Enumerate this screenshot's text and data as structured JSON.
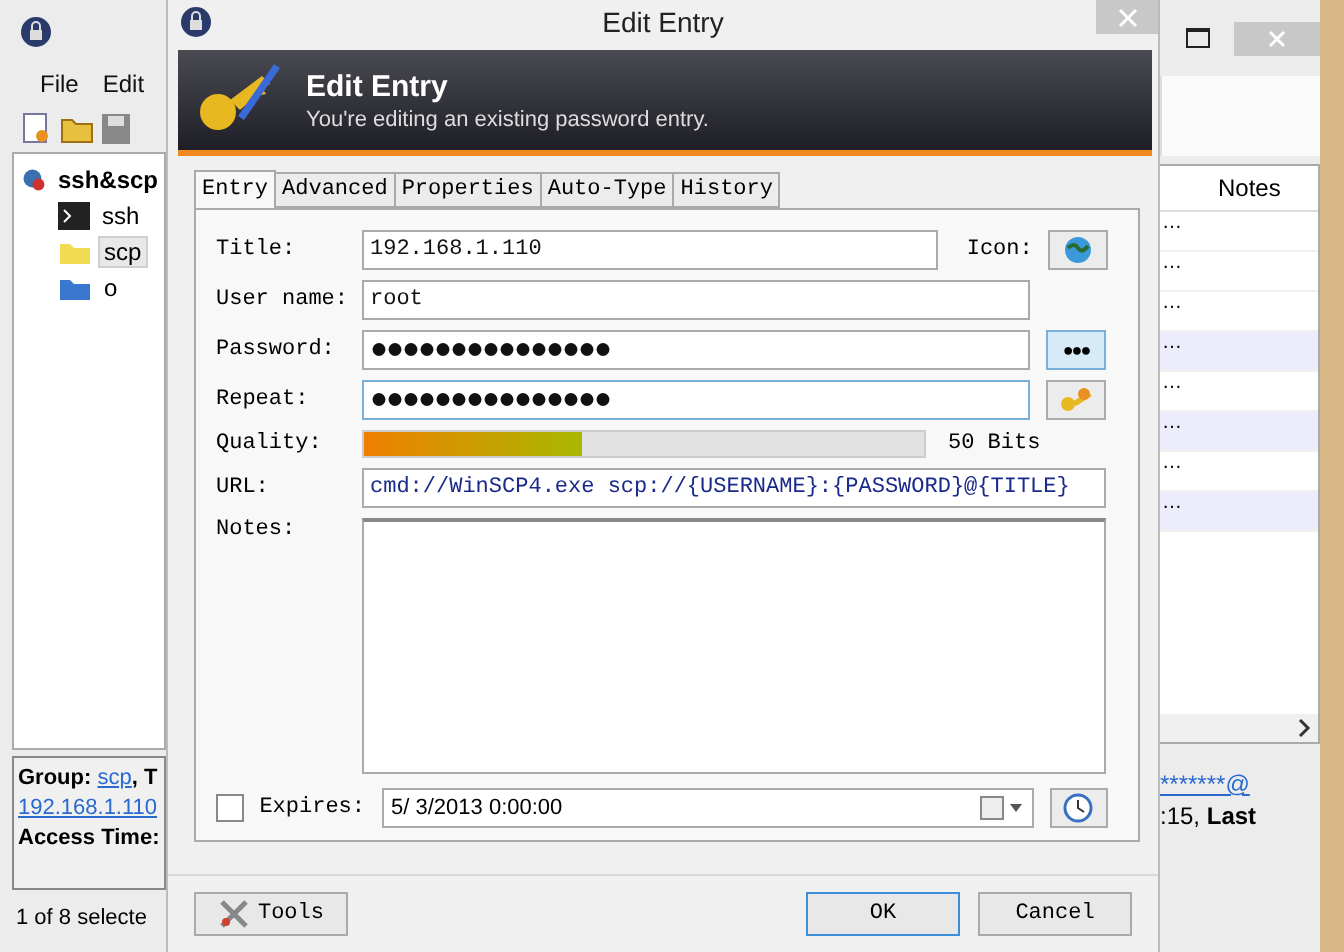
{
  "left_window": {
    "menu": [
      "File",
      "Edit"
    ],
    "tree": [
      {
        "label": "ssh&scp",
        "kind": "database",
        "selected": false,
        "children": [
          {
            "label": "ssh",
            "kind": "terminal",
            "selected": false
          },
          {
            "label": "scp",
            "kind": "folder",
            "color": "#f2dc52",
            "selected": true
          },
          {
            "label": "o",
            "kind": "folder",
            "color": "#3a78d0",
            "selected": false
          }
        ]
      }
    ],
    "info": {
      "group_label": "Group:",
      "group_link": "scp",
      "group_rest": ", T",
      "title_link": "192.168.1.110",
      "access_label": "Access Time:"
    },
    "status_bar": "1 of 8 selecte"
  },
  "dialog": {
    "title": "Edit Entry",
    "banner_title": "Edit Entry",
    "banner_subtitle": "You're editing an existing password entry.",
    "tabs": [
      {
        "label": "Entry",
        "selected": true
      },
      {
        "label": "Advanced",
        "selected": false
      },
      {
        "label": "Properties",
        "selected": false
      },
      {
        "label": "Auto-Type",
        "selected": false
      },
      {
        "label": "History",
        "selected": false
      }
    ],
    "title_field": {
      "label": "Title:",
      "value": "192.168.1.110"
    },
    "icon_label": "Icon:",
    "user_field": {
      "label": "User name:",
      "value": "root"
    },
    "password_field": {
      "label": "Password:",
      "value": "●●●●●●●●●●●●●●●"
    },
    "reveal_button": "●●●",
    "repeat_field": {
      "label": "Repeat:",
      "value": "●●●●●●●●●●●●●●●"
    },
    "quality": {
      "label": "Quality:",
      "level": 0.39,
      "reading": "50 Bits"
    },
    "url_field": {
      "label": "URL:",
      "value": "cmd://WinSCP4.exe scp://{USERNAME}:{PASSWORD}@{TITLE}"
    },
    "notes_field": {
      "label": "Notes:"
    },
    "expires": {
      "label": "Expires:",
      "checked": false,
      "value": "5/ 3/2013  0:00:00"
    },
    "buttons": {
      "tools": "Tools",
      "ok": "OK",
      "cancel": "Cancel"
    }
  },
  "right_window": {
    "column": "Notes",
    "rows": [
      "…",
      "…",
      "…",
      "…",
      "…",
      "…",
      "…",
      "…"
    ],
    "info_link": "*******@",
    "info_text": ":15, **Last**"
  }
}
